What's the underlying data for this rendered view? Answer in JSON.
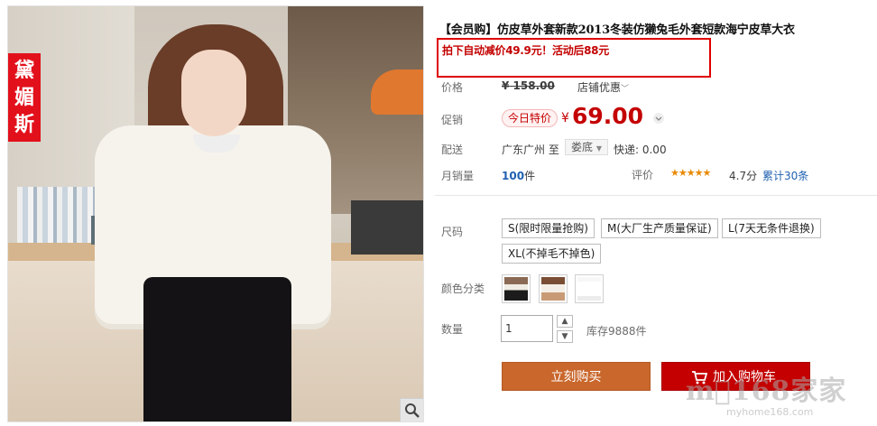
{
  "product": {
    "title": "【会员购】仿皮草外套新款2013冬装仿獭兔毛外套短款海宁皮草大衣",
    "promo_note": "拍下自动减价49.9元！活动后88元",
    "brand_badge": "黛媚斯"
  },
  "price": {
    "label": "价格",
    "currency": "¥",
    "original": "158.00",
    "shop_discount": "店铺优惠"
  },
  "promotion": {
    "label": "促销",
    "badge": "今日特价",
    "currency": "¥",
    "price": "69.00"
  },
  "shipping": {
    "label": "配送",
    "from": "广东广州",
    "to_prefix": "至",
    "to": "娄底",
    "fee": "快递: 0.00"
  },
  "sales": {
    "label": "月销量",
    "count": "100",
    "unit": "件",
    "rating_label": "评价",
    "stars": "★★★★★",
    "score": "4.7分",
    "reviews": "累计30条"
  },
  "size": {
    "label": "尺码",
    "options": [
      "S(限时限量抢购)",
      "M(大厂生产质量保证)",
      "L(7天无条件退换)",
      "XL(不掉毛不掉色)"
    ]
  },
  "color": {
    "label": "颜色分类"
  },
  "quantity": {
    "label": "数量",
    "value": "1",
    "stock": "库存9888件"
  },
  "actions": {
    "buy_now": "立刻购买",
    "add_to_cart": "加入购物车"
  },
  "watermark": {
    "text": "m⃝168家家",
    "url": "myhome168.com"
  },
  "colors": {
    "accent_red": "#c40000",
    "buy_orange": "#c9672c",
    "link_blue": "#1f60b0"
  }
}
